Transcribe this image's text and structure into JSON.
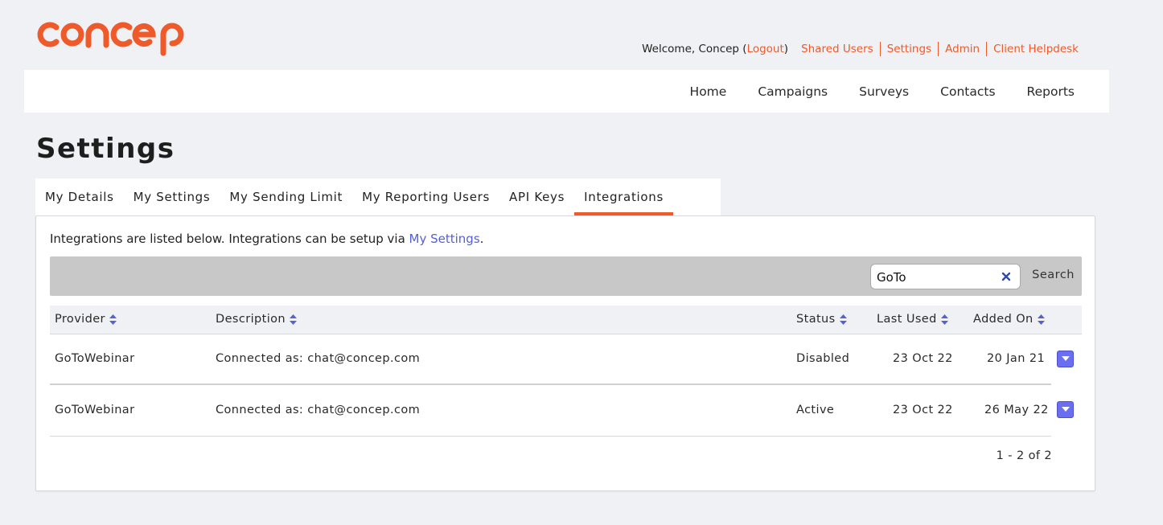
{
  "brand": {
    "logo_text": "concep",
    "accent": "#ee5a2a"
  },
  "userbar": {
    "welcome_prefix": "Welcome, Concep (",
    "logout": "Logout",
    "welcome_suffix": ")",
    "links": [
      "Shared Users",
      "Settings",
      "Admin",
      "Client Helpdesk"
    ]
  },
  "nav": {
    "items": [
      "Home",
      "Campaigns",
      "Surveys",
      "Contacts",
      "Reports"
    ]
  },
  "page": {
    "title": "Settings"
  },
  "tabs": [
    "My Details",
    "My Settings",
    "My Sending Limit",
    "My Reporting Users",
    "API Keys",
    "Integrations"
  ],
  "active_tab": "Integrations",
  "intro": {
    "text": "Integrations are listed below. Integrations can be setup via ",
    "link": "My Settings",
    "suffix": "."
  },
  "search": {
    "value": "GoTo",
    "button": "Search",
    "clear_icon": "close-icon"
  },
  "table": {
    "columns": [
      "Provider",
      "Description",
      "Status",
      "Last Used",
      "Added On"
    ],
    "rows": [
      {
        "provider": "GoToWebinar",
        "description": "Connected as: chat@concep.com",
        "status": "Disabled",
        "last_used": "23 Oct 22",
        "added_on": "20 Jan 21"
      },
      {
        "provider": "GoToWebinar",
        "description": "Connected as: chat@concep.com",
        "status": "Active",
        "last_used": "23 Oct 22",
        "added_on": "26 May 22"
      }
    ],
    "pagination": "1 - 2 of 2"
  },
  "colors": {
    "accent": "#ee5a2a",
    "link": "#5560d8",
    "action_button": "#6a6ef0",
    "background": "#f0f1f5"
  }
}
